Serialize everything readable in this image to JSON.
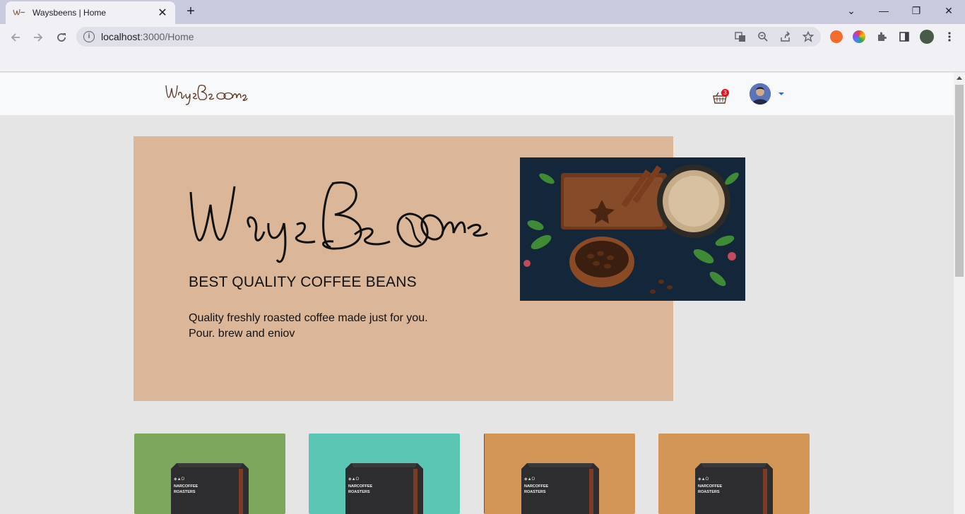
{
  "browser": {
    "tab_title": "Waysbeens | Home",
    "tab_close": "✕",
    "new_tab": "+",
    "url_host": "localhost",
    "url_rest": ":3000/Home",
    "window_controls": {
      "collapse": "⌄",
      "minimize": "—",
      "restore": "❐",
      "close": "✕"
    }
  },
  "navbar": {
    "logo_text": "WaysBeans",
    "cart_count": "3"
  },
  "hero": {
    "brand": "WaysBeans",
    "title": "BEST QUALITY COFFEE BEANS",
    "line1": "Quality freshly roasted coffee made just for you.",
    "line2": "Pour. brew and eniov"
  },
  "products": [
    {
      "bg": "#7ca75c",
      "brand": "NARCOFFEE\nROASTERS"
    },
    {
      "bg": "#5cc6b4",
      "brand": "NARCOFFEE\nROASTERS"
    },
    {
      "bg": "#d49657",
      "brand": "NARCOFFEE\nROASTERS"
    },
    {
      "bg": "#d49657",
      "brand": "NARCOFFEE\nROASTERS"
    }
  ],
  "colors": {
    "hero_bg": "#dbb698",
    "page_bg": "#e5e5e5",
    "navbar_bg": "#f8f9fb",
    "badge": "#e0141e",
    "logo": "#613d2b"
  },
  "icons": [
    "back-icon",
    "forward-icon",
    "reload-icon",
    "info-icon",
    "translate-icon",
    "zoom-icon",
    "share-icon",
    "star-icon",
    "extension-icon",
    "sidebar-icon",
    "profile-icon",
    "menu-icon",
    "cart-icon",
    "caret-down-icon"
  ]
}
